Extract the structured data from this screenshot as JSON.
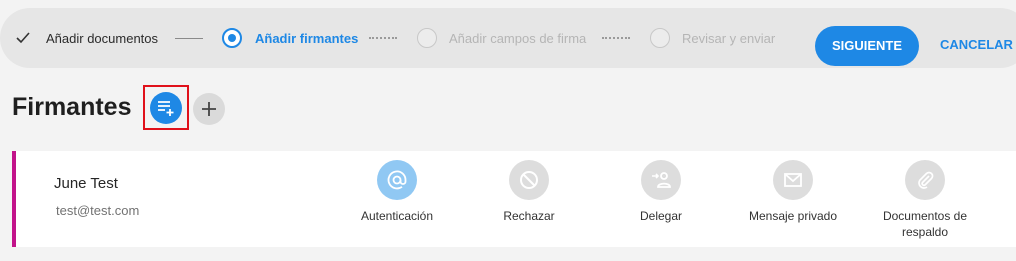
{
  "stepper": {
    "steps": [
      {
        "label": "Añadir documentos",
        "state": "done"
      },
      {
        "label": "Añadir firmantes",
        "state": "active"
      },
      {
        "label": "Añadir campos de firma",
        "state": "pending"
      },
      {
        "label": "Revisar y enviar",
        "state": "pending"
      }
    ],
    "next_label": "SIGUIENTE",
    "cancel_label": "CANCELAR"
  },
  "section": {
    "title": "Firmantes",
    "import_icon": "playlist-add-icon",
    "add_icon": "plus-icon"
  },
  "signer": {
    "name": "June Test",
    "email": "test@test.com",
    "accent_color": "#c2138a",
    "options": [
      {
        "label": "Autenticación",
        "icon": "at-sign-icon",
        "enabled": true
      },
      {
        "label": "Rechazar",
        "icon": "block-icon",
        "enabled": false
      },
      {
        "label": "Delegar",
        "icon": "delegate-user-icon",
        "enabled": false
      },
      {
        "label": "Mensaje privado",
        "icon": "mail-icon",
        "enabled": false
      },
      {
        "label": "Documentos de respaldo",
        "icon": "paperclip-icon",
        "enabled": false
      }
    ]
  },
  "colors": {
    "primary": "#1e88e5",
    "highlight": "#e0101a"
  }
}
